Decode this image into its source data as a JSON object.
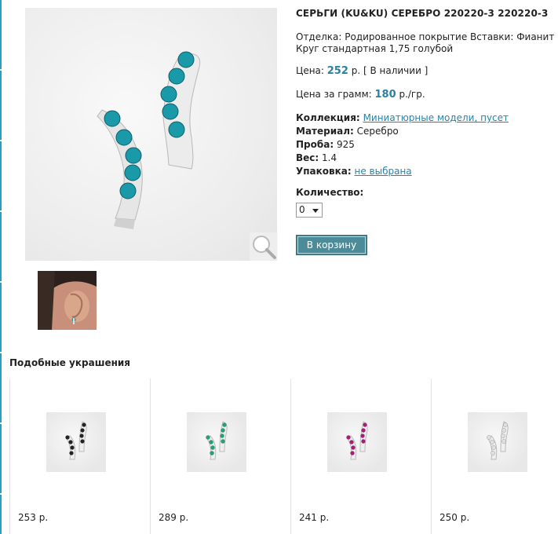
{
  "product": {
    "title": "СЕРЬГИ (KU&KU) СЕРЕБРО 220220-3 220220-3",
    "finish_line": "Отделка: Родированное покрытие Вставки: Фианит Круг стандартная 1,75 голубой",
    "price_label": "Цена: ",
    "price_value": "252",
    "price_suffix": " р. [ В наличии ]",
    "gram_label": "Цена за грамм: ",
    "gram_value": "180",
    "gram_suffix": " р./гр.",
    "collection_label": "Коллекция:",
    "collection_value": "Миниатюрные модели, пусет",
    "material_label": "Материал:",
    "material_value": "Серебро",
    "probe_label": "Проба:",
    "probe_value": "925",
    "weight_label": "Вес:",
    "weight_value": "1.4",
    "packaging_label": "Упаковка:",
    "packaging_value": "не выбрана",
    "quantity_label": "Количество:",
    "quantity_value": "0",
    "cart_button": "В корзину",
    "stone_color": "#1a9aa8"
  },
  "similar": {
    "heading": "Подобные украшения",
    "items": [
      {
        "price": "253 р.",
        "stone_color": "#222222"
      },
      {
        "price": "289 р.",
        "stone_color": "#1fa37a"
      },
      {
        "price": "241 р.",
        "stone_color": "#b0187a"
      },
      {
        "price": "250 р.",
        "stone_color": "#e0e0e0"
      }
    ]
  },
  "icons": {
    "zoom": "magnifier-icon",
    "select_arrow": "chevron-down-icon"
  }
}
